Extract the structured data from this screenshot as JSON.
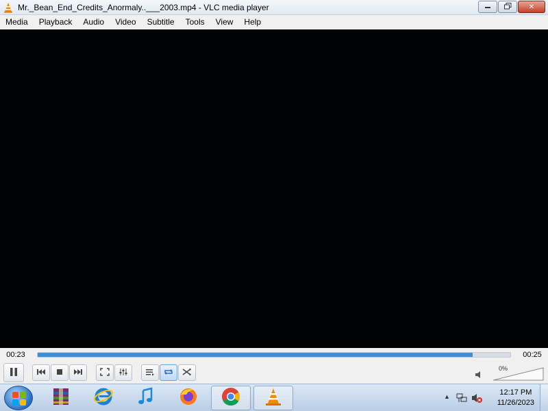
{
  "window": {
    "title": "Mr._Bean_End_Credits_Anormaly..___2003.mp4 - VLC media player",
    "controls": {
      "minimize": "",
      "restore": "",
      "close": ""
    }
  },
  "menu": {
    "items": [
      "Media",
      "Playback",
      "Audio",
      "Video",
      "Subtitle",
      "Tools",
      "View",
      "Help"
    ]
  },
  "playback": {
    "elapsed": "00:23",
    "total": "00:25",
    "progress": 0.92
  },
  "controls": {
    "pause": "pause-icon",
    "previous": "previous-icon",
    "stop": "stop-icon",
    "next": "next-icon",
    "fullscreen": "fullscreen-icon",
    "extended": "equalizer-icon",
    "playlist": "playlist-icon",
    "loop": "loop-icon",
    "random": "shuffle-icon",
    "volume_percent": "0%"
  },
  "taskbar": {
    "apps": [
      "Start",
      "WinRAR",
      "Internet Explorer",
      "iTunes",
      "Firefox",
      "Google Chrome",
      "VLC media player"
    ],
    "clock_time": "12:17 PM",
    "clock_date": "11/26/2023"
  },
  "colors": {
    "accent": "#3a8fd6",
    "titlebar": "#dfe8f2",
    "video_bg": "#010203",
    "taskbar": "#b9cde4"
  }
}
